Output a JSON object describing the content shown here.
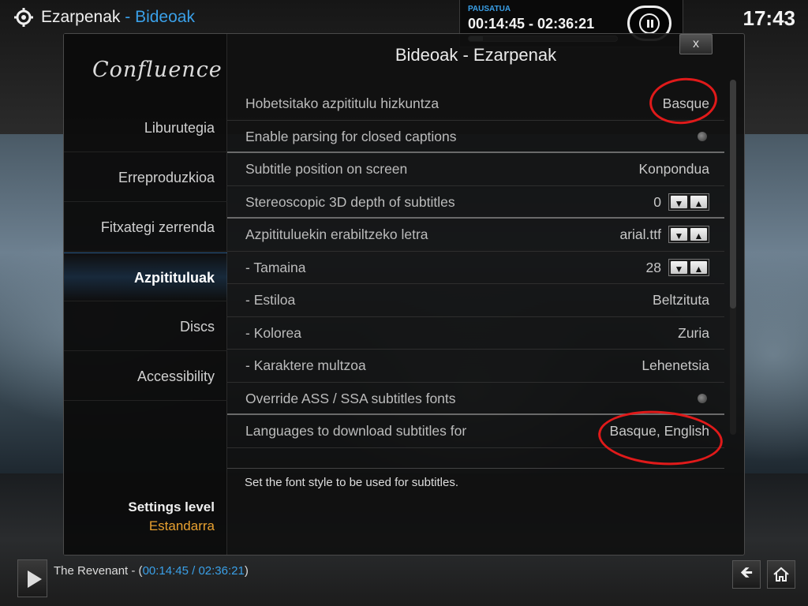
{
  "header": {
    "section": "Ezarpenak",
    "separator": " - ",
    "subsection": "Bideoak",
    "clock": "17:43"
  },
  "now_playing": {
    "status": "PAUSATUA",
    "time_range": "00:14:45 - 02:36:21",
    "progress_fraction": 0.095
  },
  "sidebar": {
    "logo": "Confluence",
    "items": [
      {
        "label": "Liburutegia",
        "active": false
      },
      {
        "label": "Erreproduzkioa",
        "active": false
      },
      {
        "label": "Fitxategi zerrenda",
        "active": false
      },
      {
        "label": "Azpitituluak",
        "active": true
      },
      {
        "label": "Discs",
        "active": false
      },
      {
        "label": "Accessibility",
        "active": false
      }
    ],
    "settings_level_label": "Settings level",
    "settings_level_value": "Estandarra"
  },
  "panel": {
    "title": "Bideoak - Ezarpenak",
    "close_label": "x",
    "rows": [
      {
        "label": "Hobetsitako azpititulu hizkuntza",
        "value": "Basque",
        "control": "value"
      },
      {
        "label": "Enable parsing for closed captions",
        "value": "",
        "control": "radio"
      },
      {
        "label": "Subtitle position on screen",
        "value": "Konpondua",
        "control": "value"
      },
      {
        "label": "Stereoscopic 3D depth of subtitles",
        "value": "0",
        "control": "spin"
      },
      {
        "label": "Azpitituluekin erabiltzeko letra",
        "value": "arial.ttf",
        "control": "spin"
      },
      {
        "label": "- Tamaina",
        "value": "28",
        "control": "spin"
      },
      {
        "label": "- Estiloa",
        "value": "Beltzituta",
        "control": "value"
      },
      {
        "label": "- Kolorea",
        "value": "Zuria",
        "control": "value"
      },
      {
        "label": "- Karaktere multzoa",
        "value": "Lehenetsia",
        "control": "value"
      },
      {
        "label": "Override ASS / SSA subtitles fonts",
        "value": "",
        "control": "radio"
      },
      {
        "label": "Languages to download subtitles for",
        "value": "Basque, English",
        "control": "value"
      }
    ],
    "description": "Set the font style to be used for subtitles."
  },
  "bottom": {
    "title": "The Revenant - (",
    "time": "00:14:45 / 02:36:21",
    "close_paren": ")"
  },
  "colors": {
    "accent_blue": "#3aa0e8",
    "accent_orange": "#e8a030",
    "annotation_red": "#e01a1a"
  }
}
